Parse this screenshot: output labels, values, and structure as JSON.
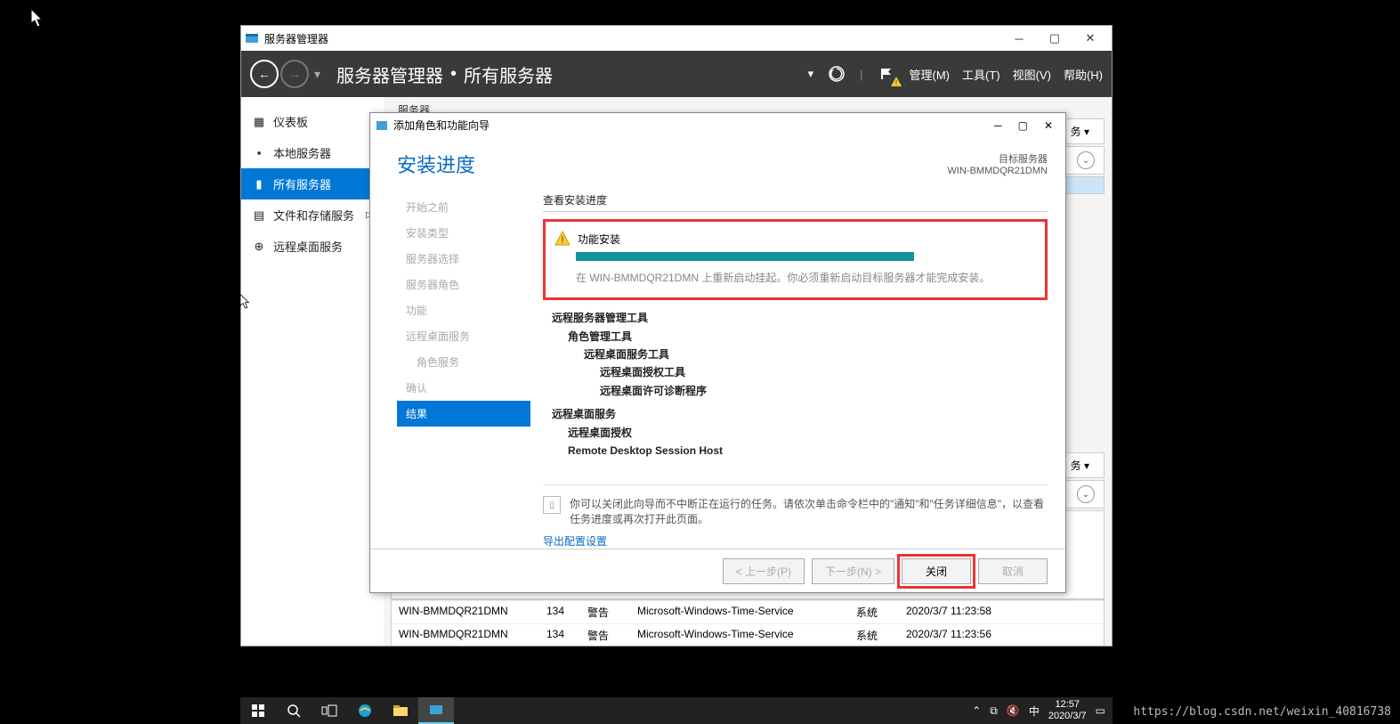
{
  "app": {
    "title": "服务器管理器"
  },
  "header": {
    "breadcrumb_app": "服务器管理器",
    "breadcrumb_page": "所有服务器",
    "menu": {
      "manage": "管理(M)",
      "tools": "工具(T)",
      "view": "视图(V)",
      "help": "帮助(H)"
    }
  },
  "sidebar": {
    "items": [
      {
        "label": "仪表板"
      },
      {
        "label": "本地服务器"
      },
      {
        "label": "所有服务器"
      },
      {
        "label": "文件和存储服务"
      },
      {
        "label": "远程桌面服务"
      }
    ]
  },
  "content": {
    "tab_label": "服务器",
    "panel_suffix1": "务 ▾",
    "panel_suffix2": "务 ▾",
    "table": {
      "rows": [
        {
          "server": "WIN-BMMDQR21DMN",
          "id": "134",
          "level": "警告",
          "source": "Microsoft-Windows-Time-Service",
          "log": "系统",
          "time": "2020/3/7 11:23:58"
        },
        {
          "server": "WIN-BMMDQR21DMN",
          "id": "134",
          "level": "警告",
          "source": "Microsoft-Windows-Time-Service",
          "log": "系统",
          "time": "2020/3/7 11:23:56"
        }
      ]
    }
  },
  "wizard": {
    "title": "添加角色和功能向导",
    "heading": "安装进度",
    "target_label": "目标服务器",
    "target_server": "WIN-BMMDQR21DMN",
    "steps": [
      {
        "label": "开始之前"
      },
      {
        "label": "安装类型"
      },
      {
        "label": "服务器选择"
      },
      {
        "label": "服务器角色"
      },
      {
        "label": "功能"
      },
      {
        "label": "远程桌面服务"
      },
      {
        "label": "角色服务",
        "sub": true
      },
      {
        "label": "确认"
      },
      {
        "label": "结果",
        "active": true
      }
    ],
    "section_title": "查看安装进度",
    "status": "功能安装",
    "pending": "在 WIN-BMMDQR21DMN 上重新启动挂起。你必须重新启动目标服务器才能完成安装。",
    "tree": {
      "a": "远程服务器管理工具",
      "a1": "角色管理工具",
      "a2": "远程桌面服务工具",
      "a3": "远程桌面授权工具",
      "a4": "远程桌面许可诊断程序",
      "b": "远程桌面服务",
      "b1": "远程桌面授权",
      "b2": "Remote Desktop Session Host"
    },
    "note": "你可以关闭此向导而不中断正在运行的任务。请依次单击命令栏中的\"通知\"和\"任务详细信息\"，以查看任务进度或再次打开此页面。",
    "export": "导出配置设置",
    "buttons": {
      "prev": "< 上一步(P)",
      "next": "下一步(N) >",
      "close": "关闭",
      "cancel": "取消"
    }
  },
  "taskbar": {
    "ime": "中",
    "time": "12:57",
    "date": "2020/3/7"
  },
  "watermark": "https://blog.csdn.net/weixin_40816738"
}
